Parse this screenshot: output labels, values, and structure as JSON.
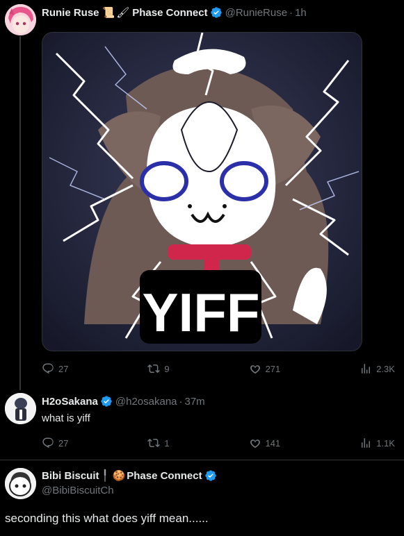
{
  "tweet1": {
    "display_name": "Runie Ruse",
    "affiliation": "Phase Connect",
    "handle": "@RunieRuse",
    "time": "1h",
    "image_text": "YIFF",
    "stats": {
      "replies": "27",
      "retweets": "9",
      "likes": "271",
      "views": "2.3K"
    }
  },
  "tweet2": {
    "display_name": "H2oSakana",
    "handle": "@h2osakana",
    "time": "37m",
    "text": "what is yiff",
    "stats": {
      "replies": "27",
      "retweets": "1",
      "likes": "141",
      "views": "1.1K"
    }
  },
  "tweet3": {
    "display_name": "Bibi Biscuit",
    "affiliation": "Phase Connect",
    "handle": "@BibiBiscuitCh",
    "text": "seconding this what does yiff mean......"
  },
  "icons": {
    "verified": "verified-badge-icon",
    "reply": "reply-icon",
    "retweet": "retweet-icon",
    "like": "heart-icon",
    "views": "views-icon"
  },
  "colors": {
    "verified": "#1d9bf0",
    "muted": "#71767b",
    "text": "#e7e9ea",
    "accent_red": "#d1264c"
  }
}
